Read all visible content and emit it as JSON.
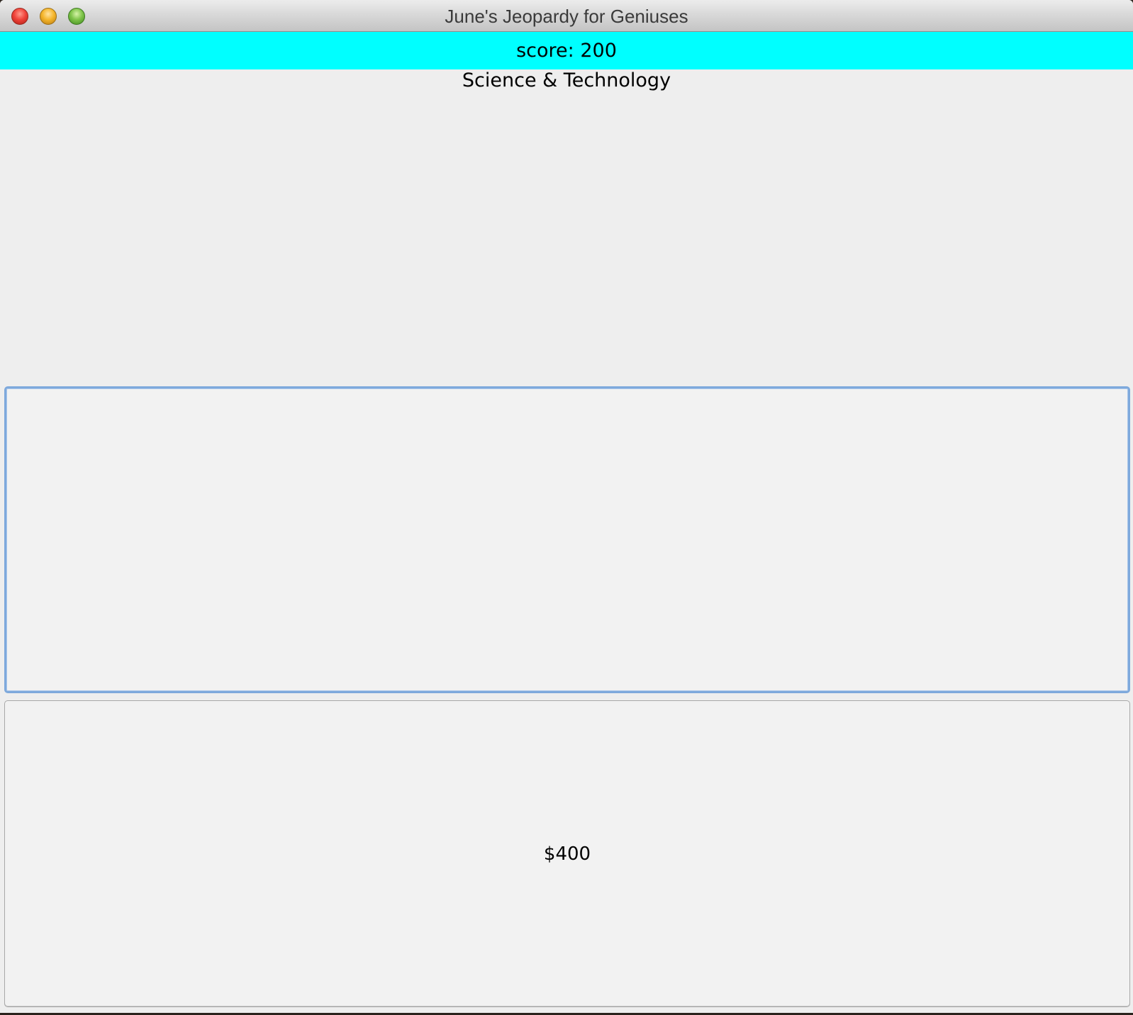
{
  "window": {
    "title": "June's Jeopardy for Geniuses"
  },
  "score_bar": {
    "text": "score: 200",
    "color": "#00ffff"
  },
  "category": {
    "name": "Science & Technology"
  },
  "question_buttons": [
    {
      "label": "",
      "state": "focused"
    },
    {
      "label": "$400",
      "state": "normal"
    }
  ]
}
